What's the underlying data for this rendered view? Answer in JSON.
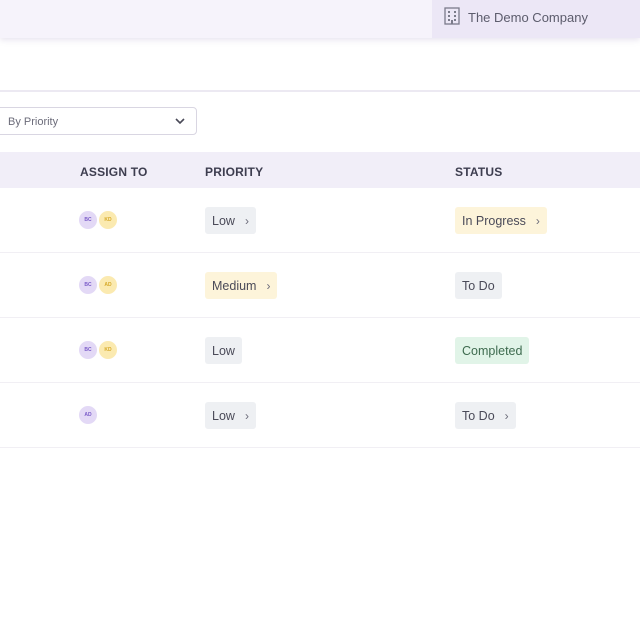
{
  "header": {
    "company_name": "The Demo Company",
    "company_icon": "building-icon"
  },
  "filter": {
    "selected": "By Priority",
    "icon": "chevron-down-icon"
  },
  "table": {
    "columns": [
      "ASSIGN TO",
      "PRIORITY",
      "STATUS"
    ],
    "rows": [
      {
        "assignees": [
          "BC",
          "KD"
        ],
        "priority": "Low",
        "status": "In Progress"
      },
      {
        "assignees": [
          "BC",
          "AD"
        ],
        "priority": "Medium",
        "status": "To Do"
      },
      {
        "assignees": [
          "BC",
          "KD"
        ],
        "priority": "Low",
        "status": "Completed"
      },
      {
        "assignees": [
          "AD"
        ],
        "priority": "Low",
        "status": "To Do"
      }
    ]
  },
  "colors": {
    "topbar_bg": "#f6f3fb",
    "header_row_bg": "#f1eef8",
    "avatar_purple": "#e3d9f6",
    "avatar_yellow": "#fbeab0",
    "pill_gray": "#eef0f3",
    "pill_yellow": "#fdf4da",
    "pill_green": "#e1f4e8"
  }
}
